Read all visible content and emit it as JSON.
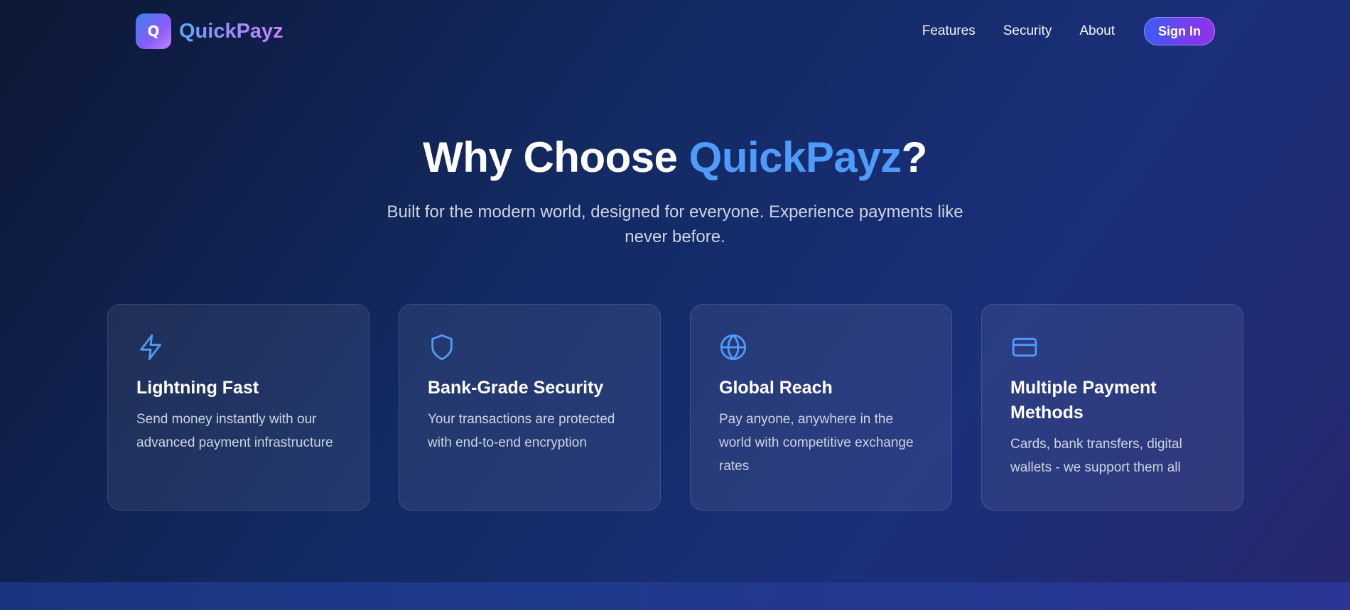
{
  "brand": {
    "logo_letter": "Q",
    "name": "QuickPayz"
  },
  "nav": {
    "links": [
      "Features",
      "Security",
      "About"
    ],
    "signin_label": "Sign In"
  },
  "hero": {
    "title_prefix": "Why Choose ",
    "title_accent": "QuickPayz",
    "title_suffix": "?",
    "subtitle": "Built for the modern world, designed for everyone. Experience payments like never before."
  },
  "features": [
    {
      "icon": "lightning-icon",
      "title": "Lightning Fast",
      "description": "Send money instantly with our advanced payment infrastructure"
    },
    {
      "icon": "shield-icon",
      "title": "Bank-Grade Security",
      "description": "Your transactions are protected with end-to-end encryption"
    },
    {
      "icon": "globe-icon",
      "title": "Global Reach",
      "description": "Pay anyone, anywhere in the world with competitive exchange rates"
    },
    {
      "icon": "credit-card-icon",
      "title": "Multiple Payment Methods",
      "description": "Cards, bank transfers, digital wallets - we support them all"
    }
  ],
  "colors": {
    "accent": "#4f9bfa",
    "icon": "#4f9bfa",
    "brand_gradient_start": "#3b82f6",
    "brand_gradient_end": "#a855f7"
  }
}
